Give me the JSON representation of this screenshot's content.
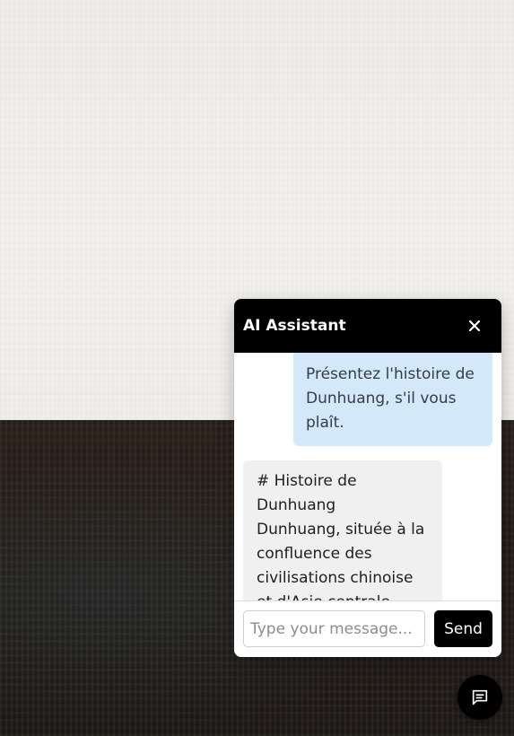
{
  "chat": {
    "title": "AI Assistant",
    "close_icon": "close-icon",
    "messages": [
      {
        "role": "user",
        "text": "Présentez l'histoire de Dunhuang, s'il vous plaît."
      },
      {
        "role": "assistant",
        "text": "# Histoire de Dunhuang\nDunhuang, située à la confluence des civilisations chinoise et d'Asie centrale"
      }
    ],
    "input": {
      "placeholder": "Type your message...",
      "value": ""
    },
    "send_label": "Send",
    "toggle_icon": "chat-message-icon"
  },
  "colors": {
    "header_bg": "#000000",
    "user_bubble": "#d3e8fb",
    "assistant_bubble": "#f0f0f0",
    "send_bg": "#000000"
  }
}
